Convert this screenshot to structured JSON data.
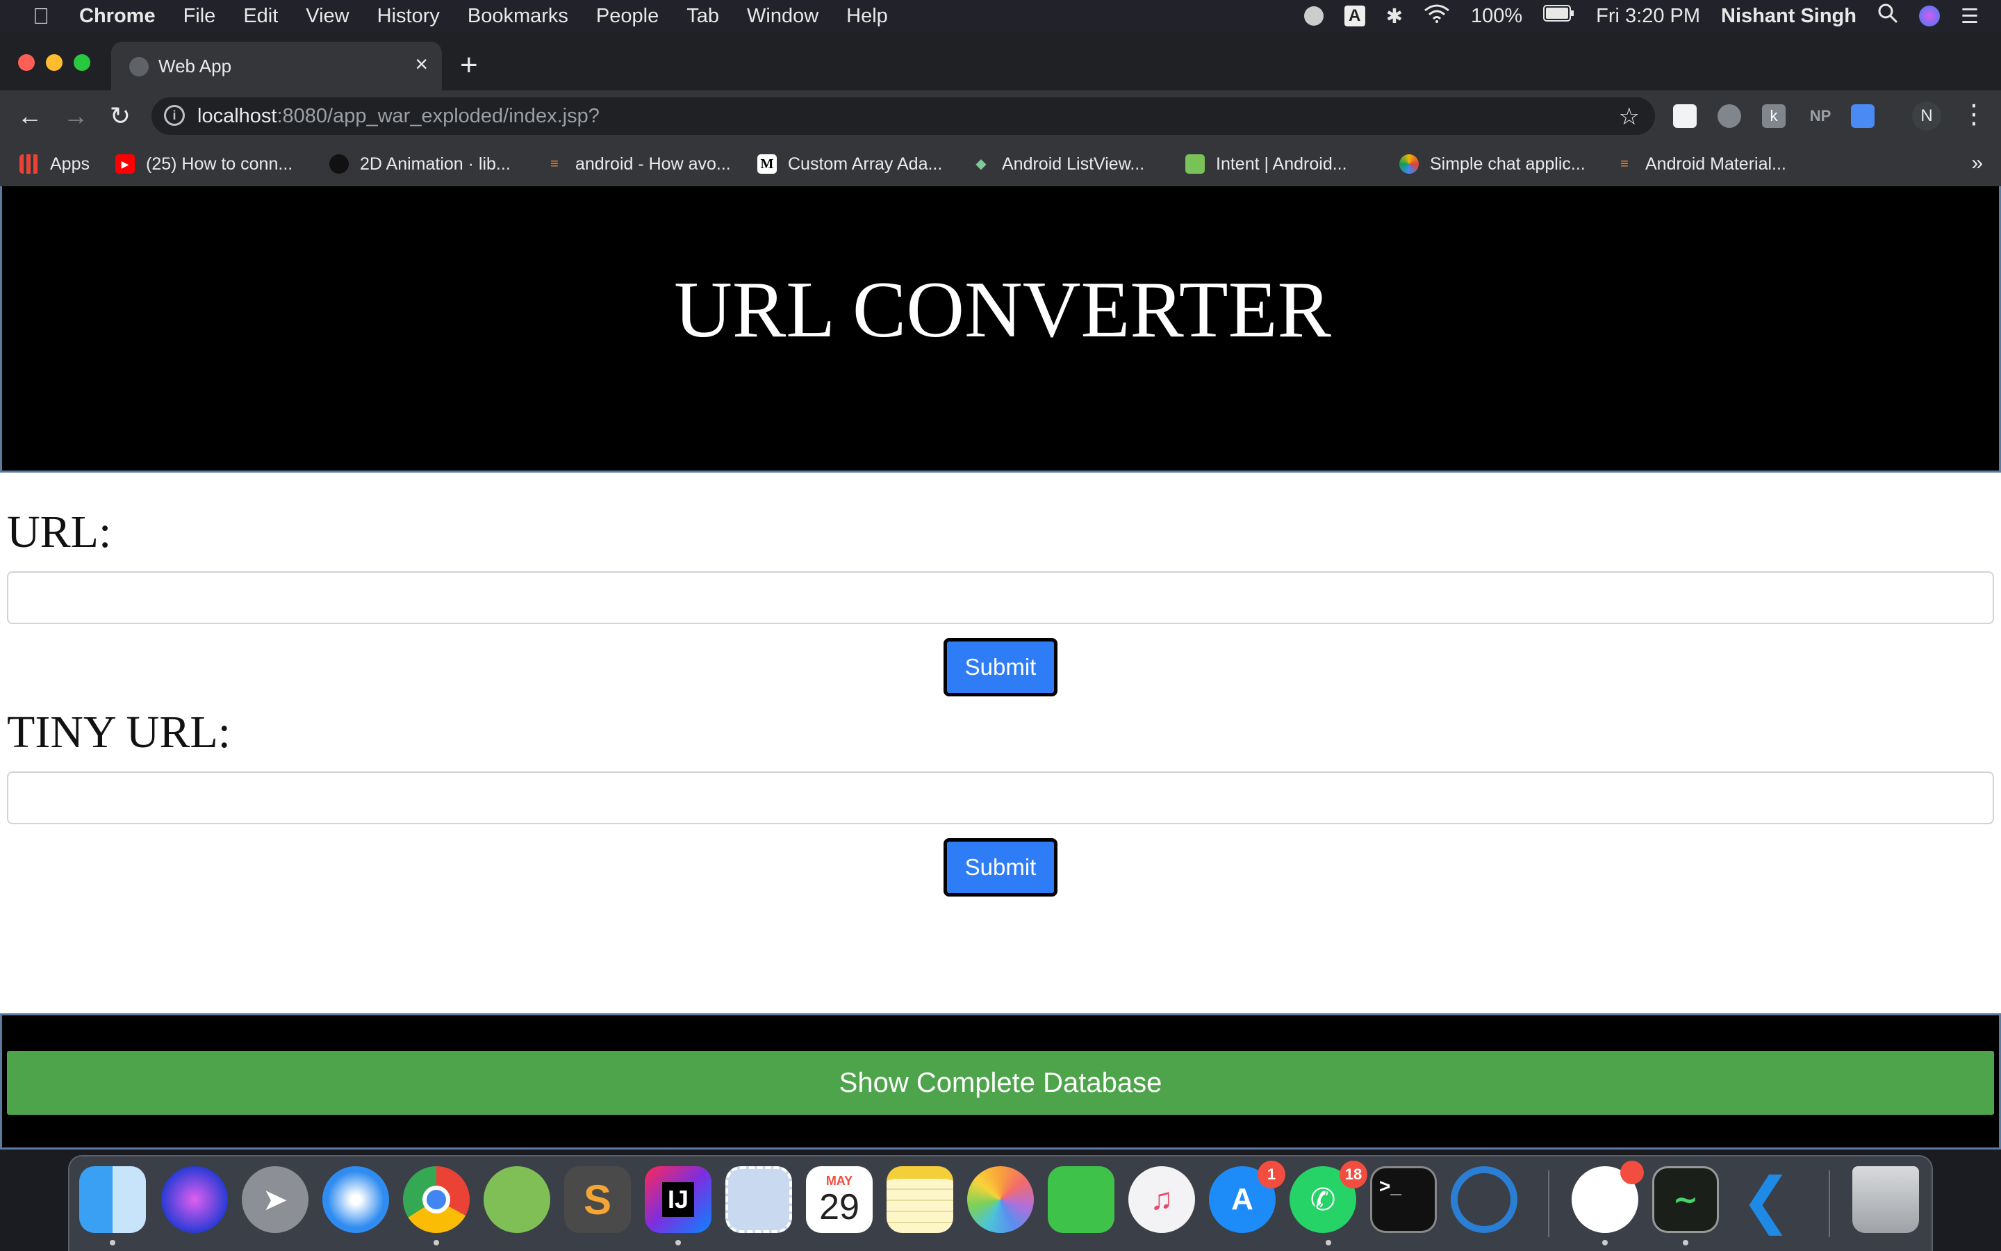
{
  "menubar": {
    "app_name": "Chrome",
    "items": [
      "File",
      "Edit",
      "View",
      "History",
      "Bookmarks",
      "People",
      "Tab",
      "Window",
      "Help"
    ],
    "battery": "100%",
    "clock": "Fri 3:20 PM",
    "user": "Nishant Singh",
    "input_source": "A"
  },
  "browser": {
    "tab_title": "Web App",
    "url_host": "localhost",
    "url_rest": ":8080/app_war_exploded/index.jsp?",
    "avatar_initial": "N",
    "ext_np": "NP",
    "bookmarks": [
      "Apps",
      "(25) How to conn...",
      "2D Animation · lib...",
      "android - How avo...",
      "Custom Array Ada...",
      "Android ListView...",
      "Intent  |  Android...",
      "Simple chat applic...",
      "Android Material..."
    ]
  },
  "page": {
    "title": "URL CONVERTER",
    "url_label": "URL:",
    "url_value": "",
    "tiny_label": "TINY URL:",
    "tiny_value": "",
    "submit_label": "Submit",
    "database_button": "Show Complete Database"
  },
  "dock": {
    "badges": {
      "app_store": "1",
      "whatsapp": "18"
    },
    "calendar_month": "MAY",
    "calendar_day": "29"
  },
  "colors": {
    "submit_blue": "#2f7df6",
    "database_green": "#4ea44b",
    "banner_black": "#000000"
  }
}
